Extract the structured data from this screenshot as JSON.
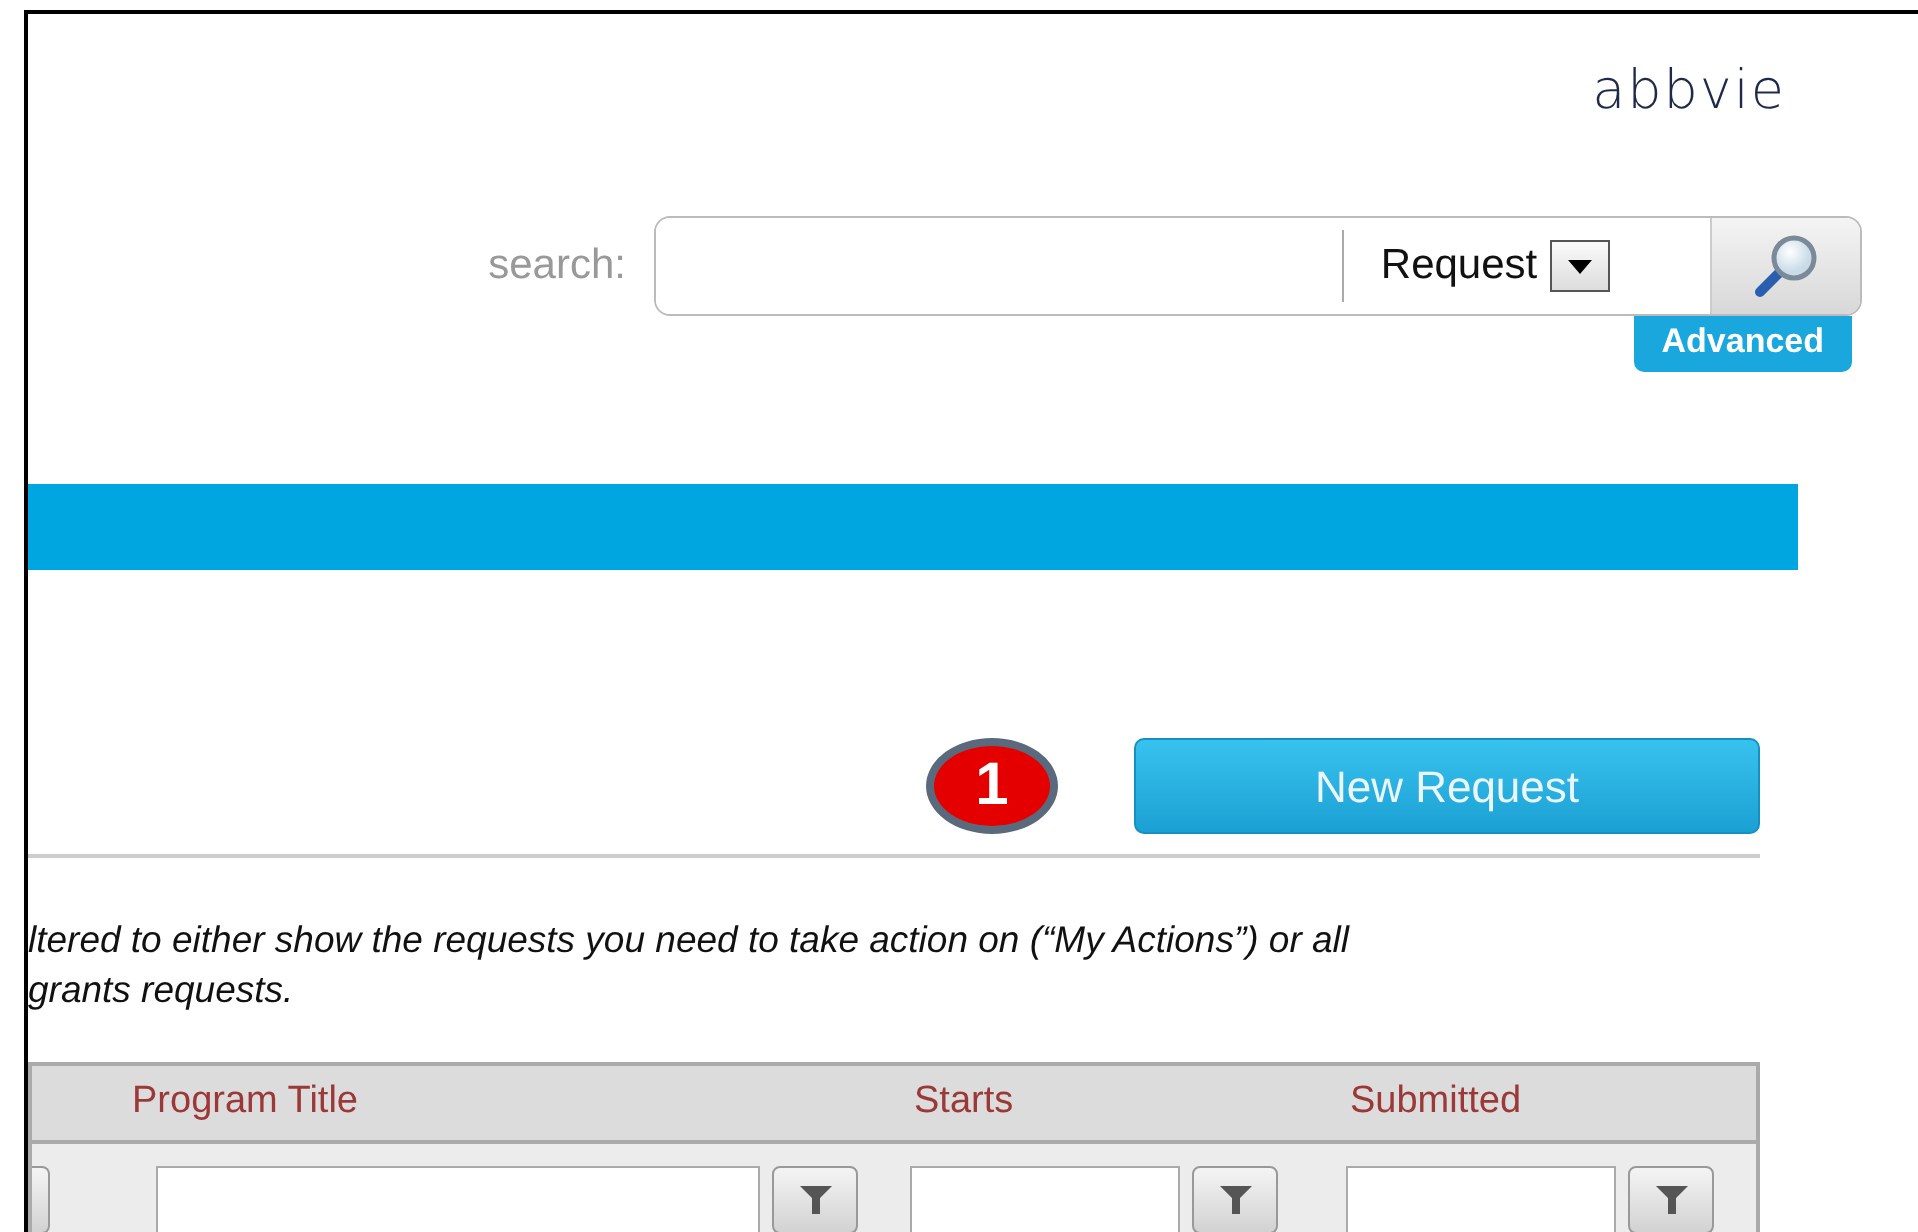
{
  "logo": {
    "text": "abbvie"
  },
  "search": {
    "label": "search:",
    "scope": "Request",
    "advanced_link": "Advanced"
  },
  "toolbar": {
    "step_badge": "1",
    "new_request_button": "New Request"
  },
  "description_lines": [
    "ltered to either show the requests you need to take action on (“My Actions”) or all",
    "grants requests."
  ],
  "table": {
    "columns": [
      {
        "kind": "cut"
      },
      {
        "kind": "full",
        "label": "Program Title"
      },
      {
        "kind": "full",
        "label": "Starts"
      },
      {
        "kind": "full",
        "label": "Submitted"
      }
    ]
  }
}
